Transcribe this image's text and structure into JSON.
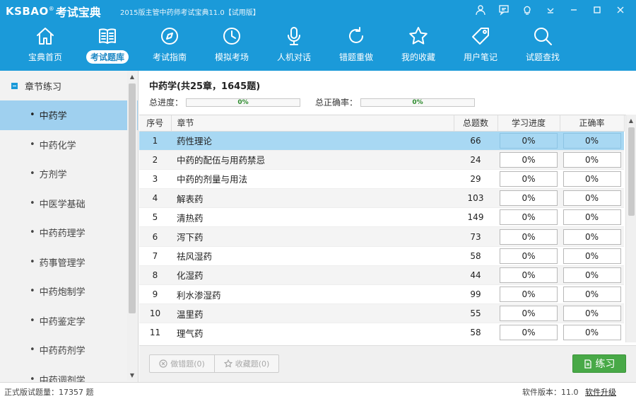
{
  "app": {
    "logo_en": "KSBAO",
    "logo_reg": "®",
    "logo_cn": "考试宝典",
    "window_title": "2015版主管中药师考试宝典11.0【试用版】"
  },
  "nav": [
    {
      "label": "宝典首页",
      "icon": "home-icon"
    },
    {
      "label": "考试题库",
      "icon": "book-icon",
      "active": true
    },
    {
      "label": "考试指南",
      "icon": "compass-icon"
    },
    {
      "label": "模拟考场",
      "icon": "clock-icon"
    },
    {
      "label": "人机对话",
      "icon": "microphone-icon"
    },
    {
      "label": "错题重做",
      "icon": "redo-icon"
    },
    {
      "label": "我的收藏",
      "icon": "star-icon"
    },
    {
      "label": "用户笔记",
      "icon": "tag-icon"
    },
    {
      "label": "试题查找",
      "icon": "search-icon"
    }
  ],
  "sidebar": {
    "header": "章节练习",
    "items": [
      {
        "label": "中药学",
        "active": true
      },
      {
        "label": "中药化学"
      },
      {
        "label": "方剂学"
      },
      {
        "label": "中医学基础"
      },
      {
        "label": "中药药理学"
      },
      {
        "label": "药事管理学"
      },
      {
        "label": "中药炮制学"
      },
      {
        "label": "中药鉴定学"
      },
      {
        "label": "中药药剂学"
      },
      {
        "label": "中药调剂学"
      }
    ]
  },
  "main": {
    "title": "中药学(共25章，1645题)",
    "progress_label": "总进度：",
    "progress_value": "0%",
    "accuracy_label": "总正确率：",
    "accuracy_value": "0%",
    "columns": [
      "序号",
      "章节",
      "总题数",
      "学习进度",
      "正确率"
    ],
    "rows": [
      {
        "no": "1",
        "name": "药性理论",
        "count": "66",
        "progress": "0%",
        "accuracy": "0%"
      },
      {
        "no": "2",
        "name": "中药的配伍与用药禁忌",
        "count": "24",
        "progress": "0%",
        "accuracy": "0%"
      },
      {
        "no": "3",
        "name": "中药的剂量与用法",
        "count": "29",
        "progress": "0%",
        "accuracy": "0%"
      },
      {
        "no": "4",
        "name": "解表药",
        "count": "103",
        "progress": "0%",
        "accuracy": "0%"
      },
      {
        "no": "5",
        "name": "清热药",
        "count": "149",
        "progress": "0%",
        "accuracy": "0%"
      },
      {
        "no": "6",
        "name": "泻下药",
        "count": "73",
        "progress": "0%",
        "accuracy": "0%"
      },
      {
        "no": "7",
        "name": "祛风湿药",
        "count": "58",
        "progress": "0%",
        "accuracy": "0%"
      },
      {
        "no": "8",
        "name": "化湿药",
        "count": "44",
        "progress": "0%",
        "accuracy": "0%"
      },
      {
        "no": "9",
        "name": "利水渗湿药",
        "count": "99",
        "progress": "0%",
        "accuracy": "0%"
      },
      {
        "no": "10",
        "name": "温里药",
        "count": "55",
        "progress": "0%",
        "accuracy": "0%"
      },
      {
        "no": "11",
        "name": "理气药",
        "count": "58",
        "progress": "0%",
        "accuracy": "0%"
      }
    ],
    "btn_wrong": "做错题(0)",
    "btn_fav": "收藏题(0)",
    "btn_practice": "练习"
  },
  "status": {
    "left": "正式版试题量：17357 题",
    "version": "软件版本：11.0",
    "upgrade": "软件升级"
  },
  "colors": {
    "header_blue": "#1b9ad9",
    "selected_row": "#a8d8f3",
    "practice_green": "#48a947"
  }
}
